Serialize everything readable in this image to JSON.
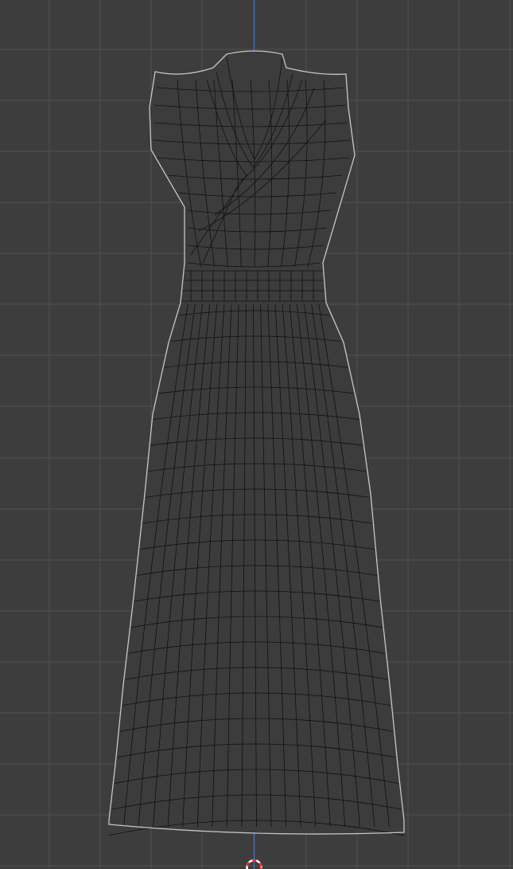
{
  "viewport": {
    "view": "front-orthographic",
    "background_color": "#3d3d3d",
    "grid_line_color": "#515151",
    "z_axis_color": "#4b78c8",
    "mesh_fill_color": "#3c3c3c",
    "wire_color": "#111111",
    "outline_color": "#c8c8c8",
    "origin_cursor_colors": [
      "#ff2a2a",
      "#ffffff"
    ]
  },
  "object": {
    "name": "dress-mesh",
    "display": "wireframe-overlay"
  }
}
